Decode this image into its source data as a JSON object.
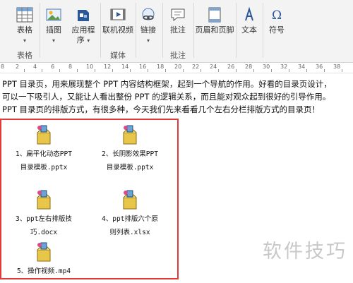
{
  "ribbon": {
    "groups": [
      {
        "id": "tables",
        "label": "表格",
        "buttons": [
          {
            "label": "表格",
            "caret": "▾",
            "icon": "table-icon"
          }
        ]
      },
      {
        "id": "illustrations",
        "label": "",
        "buttons": [
          {
            "label": "插图",
            "caret": "▾",
            "icon": "picture-icon"
          },
          {
            "label": "应用程",
            "label2": "序",
            "caret": "▾",
            "icon": "apps-icon"
          }
        ]
      },
      {
        "id": "media",
        "label": "媒体",
        "buttons": [
          {
            "label": "联机视频",
            "icon": "video-icon"
          }
        ]
      },
      {
        "id": "links",
        "label": "",
        "buttons": [
          {
            "label": "链接",
            "caret": "▾",
            "icon": "link-icon"
          }
        ]
      },
      {
        "id": "comments",
        "label": "批注",
        "buttons": [
          {
            "label": "批注",
            "icon": "comment-icon"
          }
        ]
      },
      {
        "id": "headerfooter",
        "label": "",
        "buttons": [
          {
            "label": "页眉和页脚",
            "icon": "header-footer-icon"
          }
        ]
      },
      {
        "id": "text",
        "label": "",
        "buttons": [
          {
            "label": "文本",
            "icon": "text-icon"
          }
        ]
      },
      {
        "id": "symbols",
        "label": "",
        "buttons": [
          {
            "label": "符号",
            "icon": "omega-icon"
          }
        ]
      }
    ],
    "accent": "#2b5797"
  },
  "ruler": {
    "left_mark": "8",
    "numbers": [
      "2",
      "4",
      "6",
      "8",
      "10",
      "12",
      "14",
      "16",
      "18",
      "20",
      "22",
      "24",
      "26",
      "28",
      "30",
      "32",
      "34",
      "36",
      "38"
    ]
  },
  "document": {
    "lines": [
      "PPT 目录页，用来展现整个 PPT 内容结构框架，起到一个导航的作用。好看的目录页设计，",
      "可以一下吸引人，又能让人看出整份 PPT 的逻辑关系，而且能对观众起到很好的引导作用。",
      "PPT 目录页的排版方式，有很多种，今天我们先来看看几个左右分栏排版方式的目录页！"
    ],
    "files": [
      {
        "line1": "1、扁平化动态PPT",
        "line2": "目录模板.pptx"
      },
      {
        "line1": "2、长阴影效果PPT",
        "line2": "目录模板.pptx"
      },
      {
        "line1": "3、ppt左右排版技",
        "line2": "巧.docx"
      },
      {
        "line1": "4、ppt排版六个原",
        "line2": "则列表.xlsx"
      },
      {
        "line1": "5、操作视频.mp4",
        "line2": ""
      }
    ],
    "frame_color": "#e03a3a"
  },
  "watermark": "软件技巧"
}
